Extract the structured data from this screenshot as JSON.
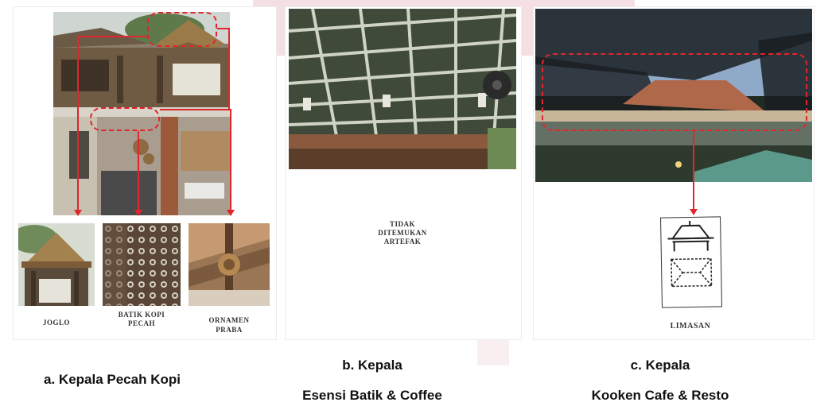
{
  "panel_a": {
    "labels": {
      "joglo": "JOGLO",
      "batik_line1": "BATIK KOPI",
      "batik_line2": "PECAH",
      "ornamen_line1": "ORNAMEN",
      "ornamen_line2": "PRABA"
    },
    "caption": "a. Kepala Pecah Kopi"
  },
  "panel_b": {
    "text_line1": "TIDAK",
    "text_line2": "DITEMUKAN",
    "text_line3": "ARTEFAK",
    "caption_line1": "b. Kepala",
    "caption_line2": "Esensi Batik & Coffee"
  },
  "panel_c": {
    "label": "LIMASAN",
    "caption_line1": "c. Kepala",
    "caption_line2": "Kooken Cafe & Resto"
  },
  "colors": {
    "annotation": "#e0262d",
    "watermark": "#f4dfe2"
  }
}
